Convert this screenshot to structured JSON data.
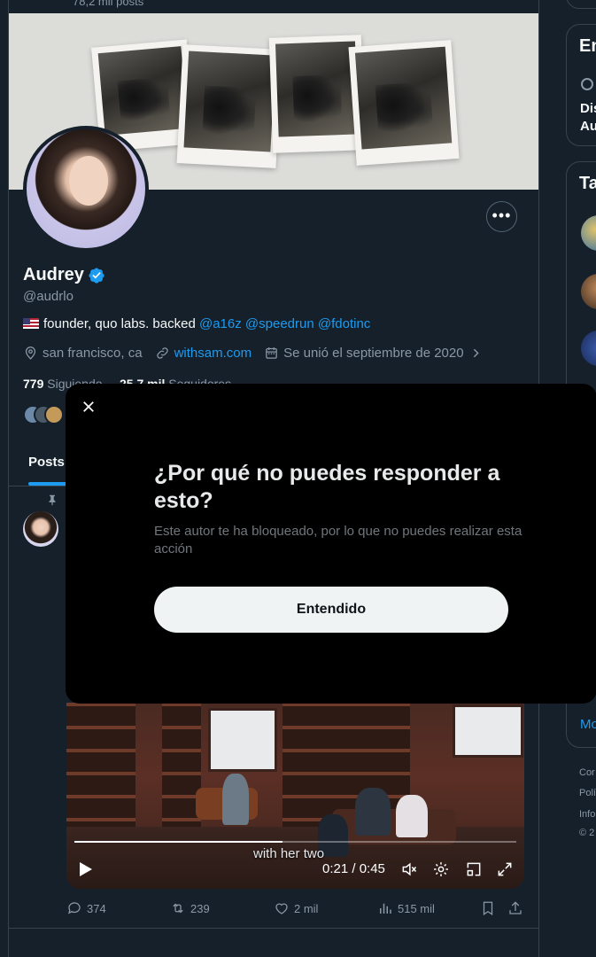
{
  "profile": {
    "post_count": "78,2 mil posts",
    "name": "Audrey",
    "handle": "@audrlo",
    "bio_text": "founder, quo labs. backed ",
    "bio_mentions": [
      "@a16z",
      "@speedrun",
      "@fdotinc"
    ],
    "location": "san francisco, ca",
    "website": "withsam.com",
    "joined": "Se unió el septiembre de 2020",
    "following_count": "779",
    "following_label": "Siguiendo",
    "followers_count": "25,7 mil",
    "followers_label": "Seguidores",
    "more_icon": "more-horizontal-icon"
  },
  "tabs": {
    "posts": "Posts"
  },
  "tweet": {
    "video": {
      "caption": "with her two",
      "time": "0:21 / 0:45",
      "progress": 0.47
    },
    "actions": {
      "replies": "374",
      "reposts": "239",
      "likes": "2 mil",
      "views": "515 mil"
    }
  },
  "sidebar": {
    "card1_title": "En",
    "card1_text1": "Dis",
    "card1_text2": "Au",
    "card2_title": "Ta",
    "show_more": "Mo",
    "footer": [
      "Cor",
      "Polí",
      "Info",
      "© 2"
    ]
  },
  "modal": {
    "title": "¿Por qué no puedes responder a esto?",
    "subtitle": "Este autor te ha bloqueado, por lo que no puedes realizar esta acción",
    "button": "Entendido"
  },
  "colors": {
    "background": "#15202b",
    "accent": "#1d9bf0",
    "modal_bg": "#000000",
    "button_bg": "#eff3f4"
  }
}
